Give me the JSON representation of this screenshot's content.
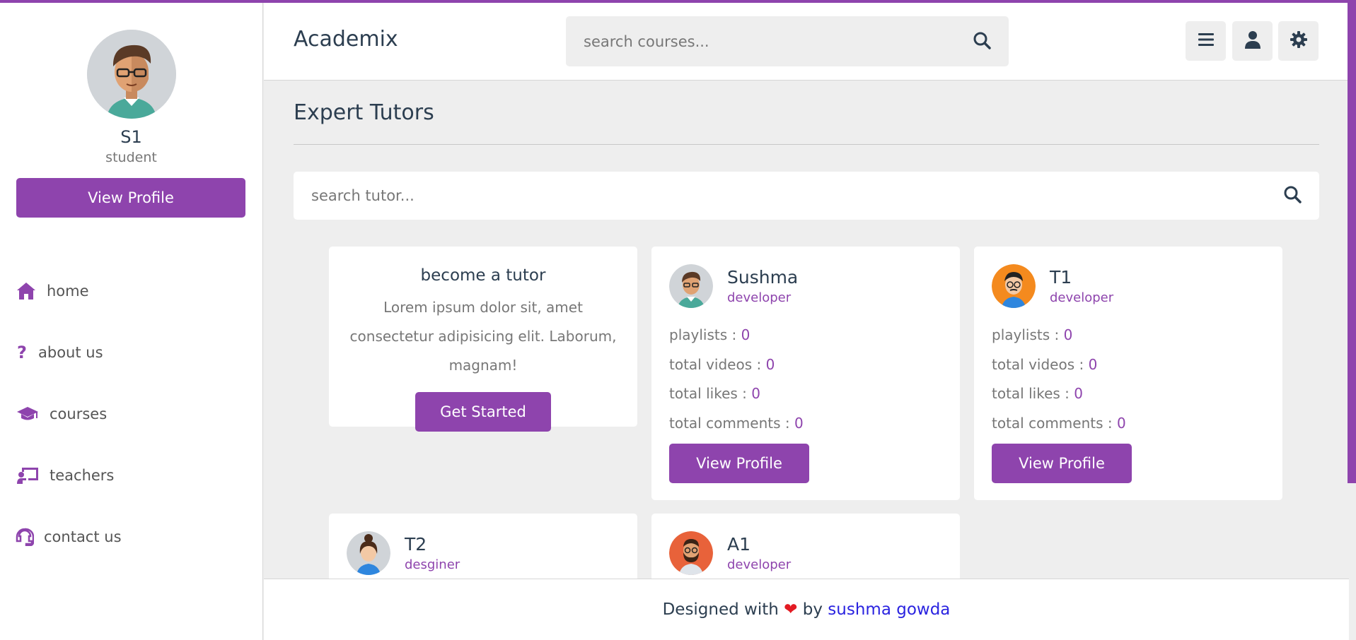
{
  "colors": {
    "accent": "#8e44ad",
    "heart": "#e31b23",
    "link": "#2a23e0"
  },
  "sidebar": {
    "name": "S1",
    "role": "student",
    "view_profile": "View Profile",
    "items": [
      {
        "label": "home",
        "icon": "home-icon"
      },
      {
        "label": "about us",
        "icon": "question-icon"
      },
      {
        "label": "courses",
        "icon": "graduation-cap-icon"
      },
      {
        "label": "teachers",
        "icon": "chalkboard-teacher-icon"
      },
      {
        "label": "contact us",
        "icon": "headset-icon"
      }
    ]
  },
  "header": {
    "logo": "Academix",
    "search_placeholder": "search courses...",
    "buttons": [
      "menu-icon",
      "user-icon",
      "gear-icon"
    ]
  },
  "main": {
    "title": "Expert Tutors",
    "search_placeholder": "search tutor...",
    "cta": {
      "title": "become a tutor",
      "text": "Lorem ipsum dolor sit, amet consectetur adipisicing elit. Laborum, magnam!",
      "button": "Get Started"
    },
    "tutors": [
      {
        "name": "Sushma",
        "role": "developer",
        "stats": [
          {
            "label": "playlists : ",
            "value": "0"
          },
          {
            "label": "total videos : ",
            "value": "0"
          },
          {
            "label": "total likes : ",
            "value": "0"
          },
          {
            "label": "total comments : ",
            "value": "0"
          }
        ],
        "button": "View Profile"
      },
      {
        "name": "T1",
        "role": "developer",
        "stats": [
          {
            "label": "playlists : ",
            "value": "0"
          },
          {
            "label": "total videos : ",
            "value": "0"
          },
          {
            "label": "total likes : ",
            "value": "0"
          },
          {
            "label": "total comments : ",
            "value": "0"
          }
        ],
        "button": "View Profile"
      },
      {
        "name": "T2",
        "role": "desginer"
      },
      {
        "name": "A1",
        "role": "developer"
      }
    ]
  },
  "footer": {
    "prefix": "Designed with ",
    "heart": "❤",
    "by": " by ",
    "author": "sushma gowda"
  }
}
